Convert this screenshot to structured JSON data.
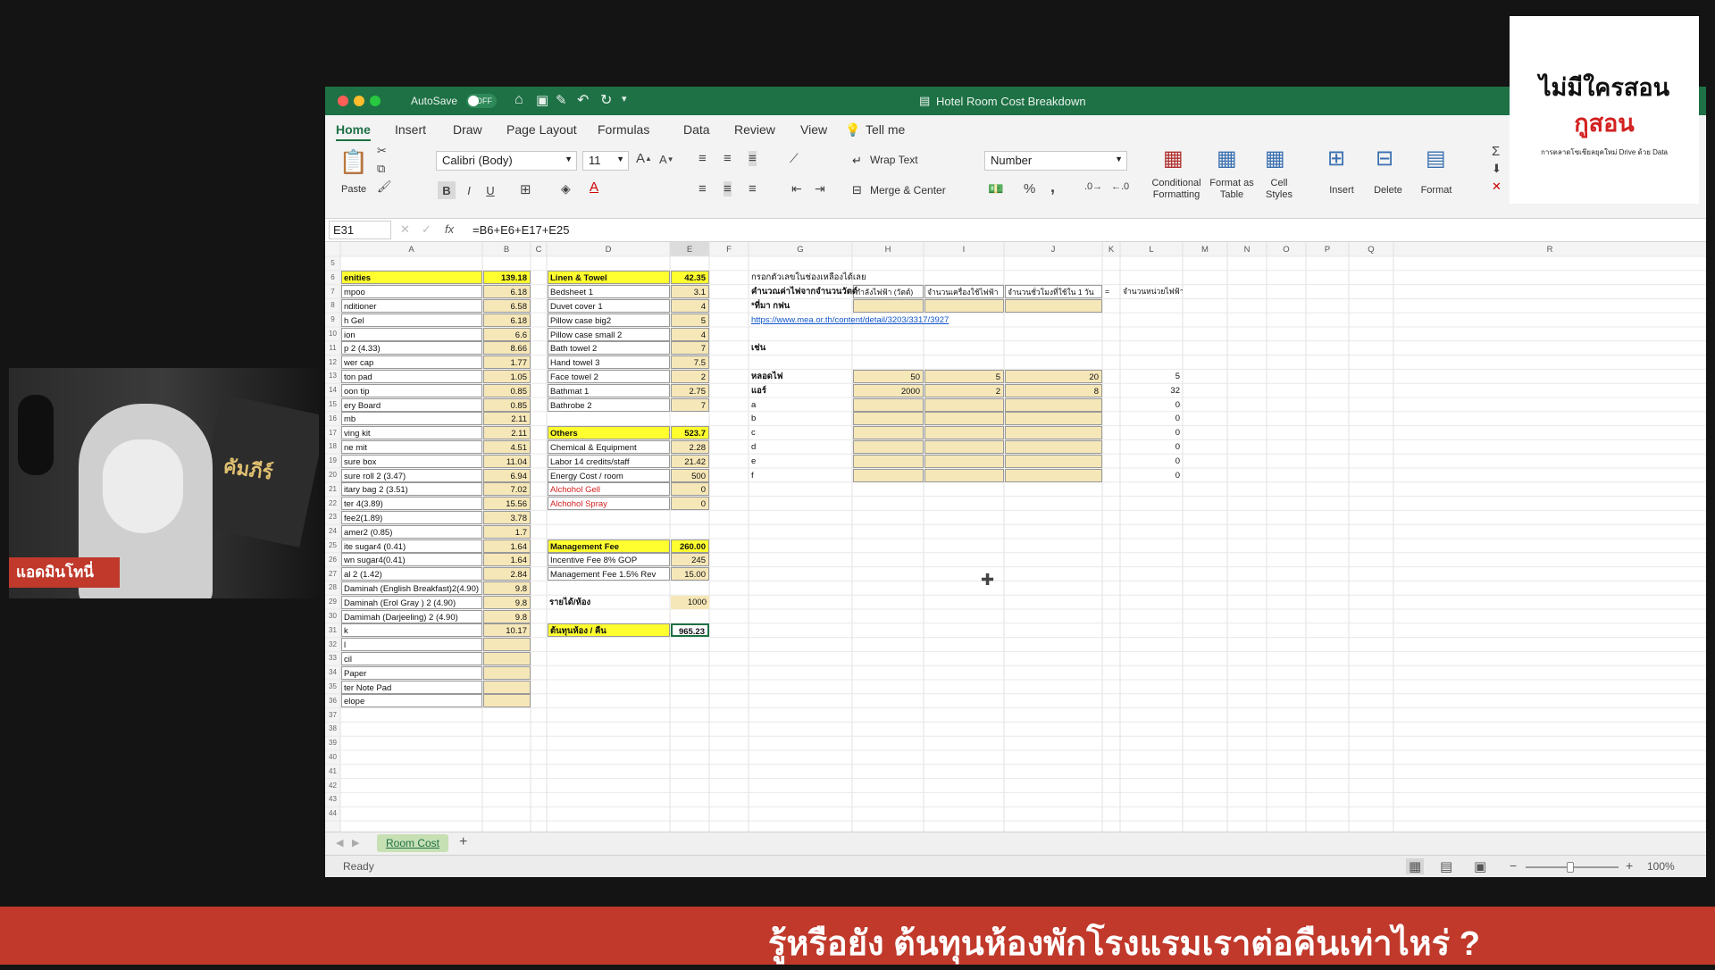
{
  "window": {
    "title": "Hotel Room Cost Breakdown",
    "autosave_label": "AutoSave",
    "autosave_state": "OFF",
    "colors": {
      "excel_green": "#1e7145",
      "selected_tab": "#c6e0b4"
    }
  },
  "ribbon_tabs": [
    "Home",
    "Insert",
    "Draw",
    "Page Layout",
    "Formulas",
    "Data",
    "Review",
    "View",
    "Tell me"
  ],
  "ribbon": {
    "paste": "Paste",
    "font_name": "Calibri (Body)",
    "font_size": "11",
    "bold": "B",
    "italic": "I",
    "underline": "U",
    "wrap_text": "Wrap Text",
    "merge_center": "Merge & Center",
    "number_format": "Number",
    "percent": "%",
    "comma": ",",
    "conditional_formatting": "Conditional Formatting",
    "format_as_table": "Format as Table",
    "cell_styles": "Cell Styles",
    "insert": "Insert",
    "delete": "Delete",
    "format": "Format"
  },
  "formula_bar": {
    "name_box": "E31",
    "fx": "fx",
    "formula": "=B6+E6+E17+E25"
  },
  "columns": [
    "A",
    "B",
    "C",
    "D",
    "E",
    "F",
    "G",
    "H",
    "I",
    "J",
    "K",
    "L",
    "M",
    "N",
    "O",
    "P",
    "Q",
    "R"
  ],
  "rows": [
    "5",
    "6",
    "7",
    "8",
    "9",
    "10",
    "11",
    "12",
    "13",
    "14",
    "15",
    "16",
    "17",
    "18",
    "19",
    "20",
    "21",
    "22",
    "23",
    "24",
    "25",
    "26",
    "27",
    "28",
    "29",
    "30",
    "31",
    "32",
    "33",
    "34",
    "35",
    "36",
    "37",
    "38",
    "39",
    "40",
    "41",
    "42",
    "43",
    "44"
  ],
  "amenities": [
    {
      "a": "enities",
      "b": "139.18"
    },
    {
      "a": "mpoo",
      "b": "6.18"
    },
    {
      "a": "nditioner",
      "b": "6.58"
    },
    {
      "a": "h Gel",
      "b": "6.18"
    },
    {
      "a": "ion",
      "b": "6.6"
    },
    {
      "a": "p 2 (4.33)",
      "b": "8.66"
    },
    {
      "a": "wer cap",
      "b": "1.77"
    },
    {
      "a": "ton pad",
      "b": "1.05"
    },
    {
      "a": "oon tip",
      "b": "0.85"
    },
    {
      "a": "ery Board",
      "b": "0.85"
    },
    {
      "a": "mb",
      "b": "2.11"
    },
    {
      "a": "ving kit",
      "b": "2.11"
    },
    {
      "a": "ne mit",
      "b": "4.51"
    },
    {
      "a": "sure box",
      "b": "11.04"
    },
    {
      "a": "sure roll 2 (3.47)",
      "b": "6.94"
    },
    {
      "a": "itary bag 2 (3.51)",
      "b": "7.02"
    },
    {
      "a": "ter 4(3.89)",
      "b": "15.56"
    },
    {
      "a": "fee2(1.89)",
      "b": "3.78"
    },
    {
      "a": "amer2 (0.85)",
      "b": "1.7"
    },
    {
      "a": "ite sugar4 (0.41)",
      "b": "1.64"
    },
    {
      "a": "wn sugar4(0.41)",
      "b": "1.64"
    },
    {
      "a": "al 2 (1.42)",
      "b": "2.84"
    },
    {
      "a": "Daminah (English Breakfast)2(4.90)",
      "b": "9.8"
    },
    {
      "a": "Daminah (Erol Gray ) 2 (4.90)",
      "b": "9.8"
    },
    {
      "a": "Damimah (Darjeeling) 2 (4.90)",
      "b": "9.8"
    },
    {
      "a": "k",
      "b": "10.17"
    },
    {
      "a": "l",
      "b": ""
    },
    {
      "a": "cil",
      "b": ""
    },
    {
      "a": "Paper",
      "b": ""
    },
    {
      "a": "ter Note Pad",
      "b": ""
    },
    {
      "a": "elope",
      "b": ""
    }
  ],
  "linen": [
    {
      "d": "Linen & Towel",
      "e": "42.35"
    },
    {
      "d": "Bedsheet 1",
      "e": "3.1"
    },
    {
      "d": "Duvet cover 1",
      "e": "4"
    },
    {
      "d": "Pillow case big2",
      "e": "5"
    },
    {
      "d": "Pillow case small 2",
      "e": "4"
    },
    {
      "d": "Bath towel 2",
      "e": "7"
    },
    {
      "d": "Hand towel 3",
      "e": "7.5"
    },
    {
      "d": "Face towel 2",
      "e": "2"
    },
    {
      "d": "Bathmat 1",
      "e": "2.75"
    },
    {
      "d": "Bathrobe 2",
      "e": "7"
    }
  ],
  "others": [
    {
      "d": "Others",
      "e": "523.7"
    },
    {
      "d": "Chemical & Equipment",
      "e": "2.28"
    },
    {
      "d": "Labor 14 credits/staff",
      "e": "21.42"
    },
    {
      "d": "Energy Cost / room",
      "e": "500"
    },
    {
      "d": "Alchohol Gell",
      "e": "0"
    },
    {
      "d": "Alchohol Spray",
      "e": "0"
    }
  ],
  "management": [
    {
      "d": "Management Fee",
      "e": "260.00"
    },
    {
      "d": "Incentive Fee 8% GOP",
      "e": "245"
    },
    {
      "d": "Management Fee 1.5% Rev",
      "e": "15.00"
    }
  ],
  "revenue": {
    "d": "รายได้/ห้อง",
    "e": "1000"
  },
  "total": {
    "d": "ต้นทุนห้อง / คืน",
    "e": "965.23"
  },
  "energy": {
    "note": "กรอกตัวเลขในช่องเหลืองได้เลย",
    "headers": [
      "กำลังไฟฟ้า (วัตต์)",
      "จำนวนเครื่องใช้ไฟฟ้า",
      "จำนวนชั่วโมงที่ใช้ใน 1 วัน",
      "=",
      "จำนวนหน่วยไฟฟ้า"
    ],
    "rate_label": "คำนวณค่าไฟจากจำนวนวัตต์",
    "source_label": "*ที่มา กฟน",
    "link": "https://www.mea.or.th/content/detail/3203/3317/3927",
    "example": "เช่น",
    "rows": [
      {
        "g": "หลอดไฟ",
        "h": "50",
        "i": "5",
        "j": "20",
        "l": "5"
      },
      {
        "g": "แอร์",
        "h": "2000",
        "i": "2",
        "j": "8",
        "l": "32"
      },
      {
        "g": "a",
        "h": "",
        "i": "",
        "j": "",
        "l": "0"
      },
      {
        "g": "b",
        "h": "",
        "i": "",
        "j": "",
        "l": "0"
      },
      {
        "g": "c",
        "h": "",
        "i": "",
        "j": "",
        "l": "0"
      },
      {
        "g": "d",
        "h": "",
        "i": "",
        "j": "",
        "l": "0"
      },
      {
        "g": "e",
        "h": "",
        "i": "",
        "j": "",
        "l": "0"
      },
      {
        "g": "f",
        "h": "",
        "i": "",
        "j": "",
        "l": "0"
      }
    ]
  },
  "sheet_tab": "Room Cost",
  "status": {
    "ready": "Ready",
    "zoom": "100%"
  },
  "webcam": {
    "name": "แอดมินโทนี่",
    "bg_text": "คัมภีร์"
  },
  "badge": {
    "line1": "ไม่มีใครสอน",
    "line2": "กูสอน",
    "line3": "การตลาดโซเชียลยุคใหม่ Drive ด้วย Data"
  },
  "banner": {
    "text": "รู้หรือยัง ต้นทุนห้องพักโรงแรมเราต่อคืนเท่าไหร่ ?"
  }
}
